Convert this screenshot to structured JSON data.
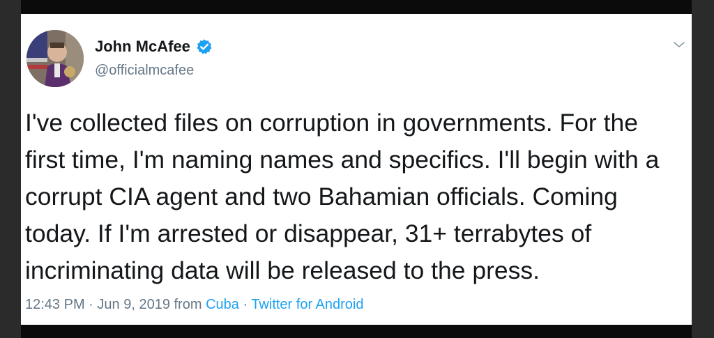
{
  "tweet": {
    "author_name": "John McAfee",
    "author_handle": "@officialmcafee",
    "text_lines": [
      "I've collected files on corruption in governments. For the",
      "first time, I'm naming names and specifics. I'll begin with a",
      "corrupt CIA agent and two Bahamian officials. Coming",
      "today. If I'm arrested or disappear, 31+ terrabytes of",
      "incriminating data will be released to the press."
    ],
    "time": "12:43 PM",
    "date": "Jun 9, 2019",
    "from_prefix": "from",
    "location": "Cuba",
    "source": "Twitter for Android",
    "separator": "·"
  },
  "icons": {
    "verified": "verified-badge-icon",
    "menu": "chevron-down-icon"
  },
  "colors": {
    "verified_blue": "#1da1f2",
    "link_blue": "#1da1f2",
    "secondary_text": "#657786",
    "primary_text": "#14171a"
  }
}
